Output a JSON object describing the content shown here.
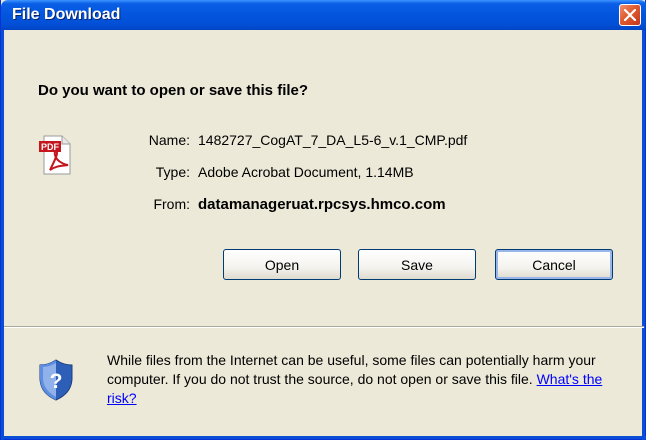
{
  "window": {
    "title": "File Download",
    "close_icon": "close-icon"
  },
  "question": "Do you want to open or save this file?",
  "file": {
    "icon": "pdf-file-icon",
    "name_label": "Name:",
    "name_value": "1482727_CogAT_7_DA_L5-6_v.1_CMP.pdf",
    "type_label": "Type:",
    "type_value": "Adobe Acrobat Document, 1.14MB",
    "from_label": "From:",
    "from_value": "datamanageruat.rpcsys.hmco.com"
  },
  "buttons": {
    "open": "Open",
    "save": "Save",
    "cancel": "Cancel"
  },
  "warning": {
    "icon": "security-shield-icon",
    "text": "While files from the Internet can be useful, some files can potentially harm your computer. If you do not trust the source, do not open or save this file.",
    "link": "What's the risk?"
  },
  "colors": {
    "titlebar": "#0355dd",
    "dialog_bg": "#ece9d8",
    "link": "#0000ff",
    "close_button": "#e05a2e"
  }
}
